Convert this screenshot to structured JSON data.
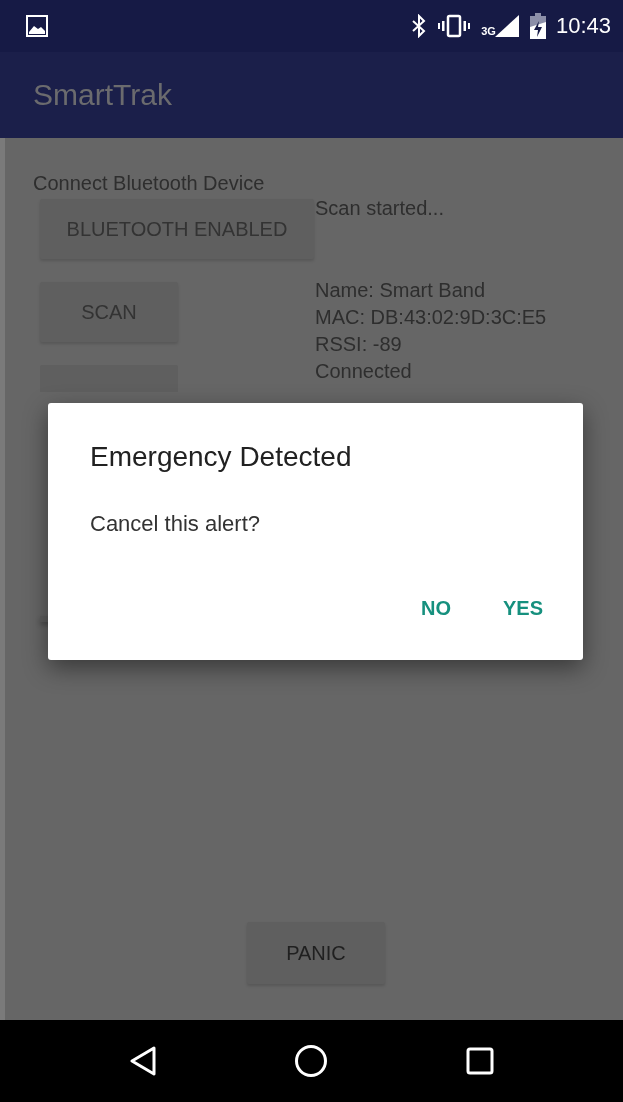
{
  "status_bar": {
    "network": "3G",
    "time": "10:43"
  },
  "app_bar": {
    "title": "SmartTrak"
  },
  "content": {
    "heading": "Connect Bluetooth Device",
    "buttons": [
      {
        "label": "BLUETOOTH ENABLED",
        "disabled": true
      },
      {
        "label": "SCAN",
        "disabled": true
      }
    ],
    "status_text": "Scan started...",
    "device_info": [
      "Name: Smart Band",
      "MAC: DB:43:02:9D:3C:E5",
      "RSSI: -89",
      "Connected"
    ],
    "panic_button": {
      "label": "PANIC"
    }
  },
  "dialog": {
    "title": "Emergency Detected",
    "message": "Cancel this alert?",
    "buttons": [
      "NO",
      "YES"
    ]
  }
}
